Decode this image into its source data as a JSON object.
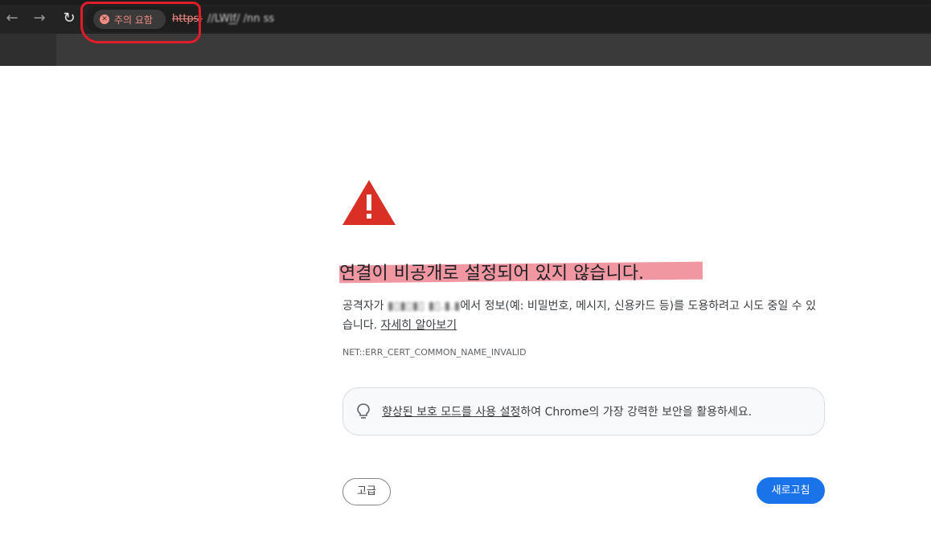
{
  "browser": {
    "security_chip_label": "주의 요함",
    "url_scheme": "https:",
    "url_rest": "//LWI̲f̲/ /nn ss",
    "nav": {
      "back": "←",
      "forward": "→",
      "reload": "↻"
    }
  },
  "page": {
    "heading": "연결이 비공개로 설정되어 있지 않습니다.",
    "body_prefix": "공격자가 ",
    "body_host": "▮▯▮▯▮▯ ▮▯.▮.▮",
    "body_suffix": "에서 정보(예: 비밀번호, 메시지, 신용카드 등)를 도용하려고 시도 중일 수 있습니다. ",
    "learn_more": "자세히 알아보기",
    "error_code": "NET::ERR_CERT_COMMON_NAME_INVALID",
    "hint_link": "향상된 보호 모드를 사용 설정",
    "hint_text": "하여 Chrome의 가장 강력한 보안을 활용하세요.",
    "advanced_button": "고급",
    "reload_button": "새로고침"
  },
  "icons": {
    "warning": "warning-triangle-icon",
    "bulb": "lightbulb-icon",
    "chip": "error-circle-icon"
  },
  "colors": {
    "warning_red": "#d93025",
    "primary_blue": "#1a73e8",
    "chip_red": "#f28b82",
    "annotation_red": "#e11d2a",
    "highlight_pink": "#f08c98"
  }
}
